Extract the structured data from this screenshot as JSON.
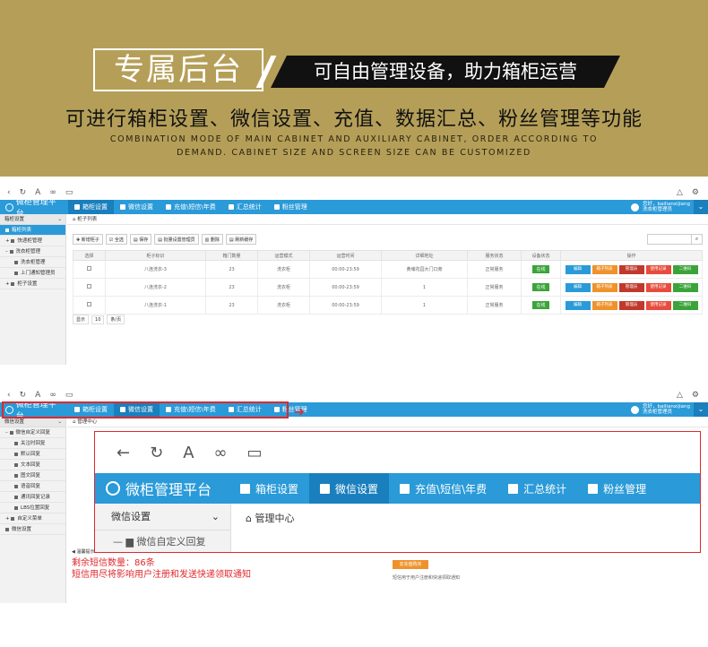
{
  "banner": {
    "title": "专属后台",
    "slogan": "可自由管理设备，助力箱柜运营",
    "features": "可进行箱柜设置、微信设置、充值、数据汇总、粉丝管理等功能",
    "english_line1": "COMBINATION MODE OF MAIN CABINET AND AUXILIARY CABINET, ORDER ACCORDING TO",
    "english_line2": "DEMAND. CABINET SIZE AND SCREEN SIZE CAN BE CUSTOMIZED"
  },
  "browser": {
    "icons": [
      "back-icon",
      "refresh-icon",
      "font-icon",
      "link-icon",
      "window-icon"
    ],
    "right_icons": [
      "share-icon",
      "settings-icon"
    ]
  },
  "app": {
    "logo": "微柜管理平台",
    "nav": [
      "箱柜设置",
      "微信设置",
      "充值\\短信\\年费",
      "汇总统计",
      "粉丝管理"
    ],
    "user_line1": "您好，bailianxijiang",
    "user_line2": "洗衣柜管理员"
  },
  "screen1": {
    "sidebar_head": "箱柜设置",
    "sidebar_items": [
      "箱柜列表",
      "快递柜管理",
      "洗衣柜管理",
      "洗衣柜管理",
      "上门通知管理员",
      "柜子设置"
    ],
    "crumb": "柜子列表",
    "toolbar": [
      "新增柜子",
      "全选",
      "保存",
      "批量设置管理员",
      "删除",
      "刷新缓存"
    ],
    "columns": [
      "选择",
      "柜子标识",
      "箱门数量",
      "运营模式",
      "运营时间",
      "详细地址",
      "服务状态",
      "设备状态",
      "操作"
    ],
    "rows": [
      {
        "id": "八连洗衣-3",
        "doors": "23",
        "mode": "洗衣柜",
        "time": "00:00-23:59",
        "addr": "黄埔花园大门口旁",
        "service": "正常服务",
        "device": "在线"
      },
      {
        "id": "八连洗衣-2",
        "doors": "23",
        "mode": "洗衣柜",
        "time": "00:00-23:59",
        "addr": "1",
        "service": "正常服务",
        "device": "在线"
      },
      {
        "id": "八连洗衣-1",
        "doors": "23",
        "mode": "洗衣柜",
        "time": "00:00-23:59",
        "addr": "1",
        "service": "正常服务",
        "device": "在线"
      }
    ],
    "ops": [
      "编辑",
      "箱子列表",
      "管理员",
      "使用记录",
      "二维码"
    ],
    "pager": [
      "显示",
      "10",
      "条/页"
    ]
  },
  "screen2": {
    "sidebar_head": "微信设置",
    "sidebar_items": [
      "微信自定义回复",
      "关注时回复",
      "默认回复",
      "文本回复",
      "图文回复",
      "语音回复",
      "通讯回复记录",
      "LBS位置回复",
      "自定义菜单",
      "微信设置"
    ],
    "crumb": "管理中心",
    "zoom_crumb": "管理中心",
    "zoom_side_head": "微信设置",
    "zoom_side_item": "微信自定义回复",
    "notice_head": "温馨提示",
    "notice_line1": "剩余短信数量：86条",
    "notice_line2": "短信用尽将影响用户注册和发送快递领取通知",
    "sms_btn": "去充值购买",
    "sms_desc": "短信用于用户注册和快递领取通知"
  }
}
